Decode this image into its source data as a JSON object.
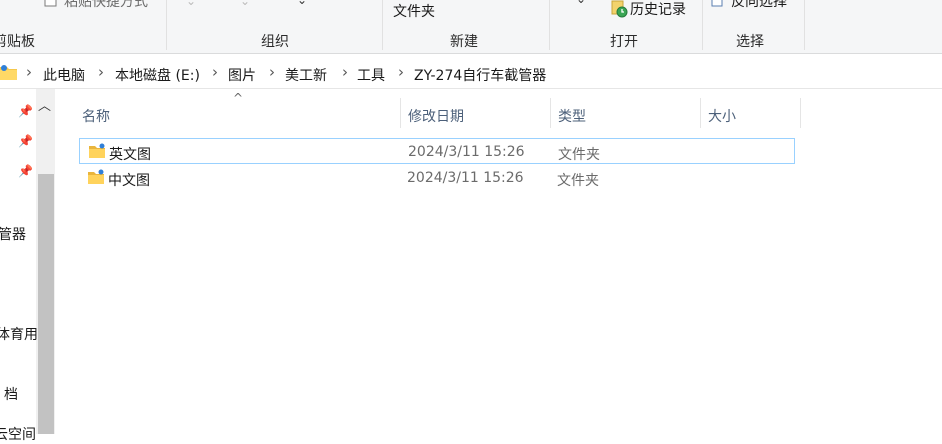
{
  "ribbon": {
    "clipboard": {
      "paste_shortcut_label": "粘贴快捷方式",
      "group_label": "剪贴板"
    },
    "organize": {
      "group_label": "组织"
    },
    "new": {
      "new_folder_label": "文件夹",
      "group_label": "新建"
    },
    "open": {
      "history_label": "历史记录",
      "group_label": "打开"
    },
    "select": {
      "invert_label": "反向选择",
      "group_label": "选择"
    }
  },
  "address": {
    "crumbs": [
      "此电脑",
      "本地磁盘 (E:)",
      "图片",
      "美工新",
      "工具",
      "ZY-274自行车截管器"
    ]
  },
  "nav": {
    "items": [
      "管器",
      "体育用",
      "档",
      "云空间"
    ]
  },
  "columns": {
    "name": "名称",
    "modified": "修改日期",
    "type": "类型",
    "size": "大小"
  },
  "files": [
    {
      "name": "英文图",
      "modified": "2024/3/11 15:26",
      "type": "文件夹",
      "size": ""
    },
    {
      "name": "中文图",
      "modified": "2024/3/11 15:26",
      "type": "文件夹",
      "size": ""
    }
  ]
}
